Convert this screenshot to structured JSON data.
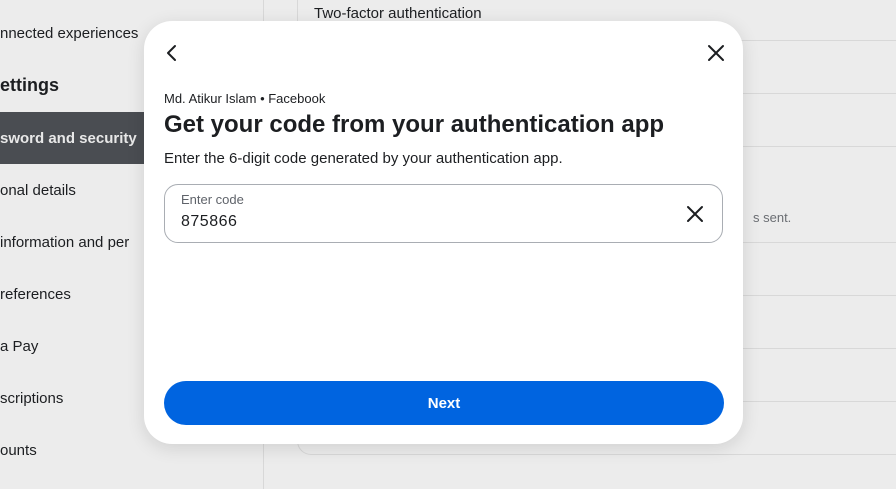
{
  "background": {
    "sidebar": {
      "items": [
        {
          "label": "nnected experiences"
        },
        {
          "label": "ettings"
        },
        {
          "label": "sword and security"
        },
        {
          "label": "onal details"
        },
        {
          "label": " information and per"
        },
        {
          "label": "references"
        },
        {
          "label": "a Pay"
        },
        {
          "label": "scriptions"
        },
        {
          "label": "ounts"
        }
      ]
    },
    "content": {
      "first_row": "Two-factor authentication",
      "partial_note": "s sent."
    }
  },
  "modal": {
    "account_line": "Md. Atikur Islam • Facebook",
    "title": "Get your code from your authentication app",
    "subtitle": "Enter the 6-digit code generated by your authentication app.",
    "code_field": {
      "label": "Enter code",
      "value": "875866"
    },
    "next_label": "Next",
    "accent_color": "#0064e0",
    "icons": {
      "back": "chevron-left-icon",
      "close": "close-icon",
      "clear": "clear-icon"
    }
  }
}
